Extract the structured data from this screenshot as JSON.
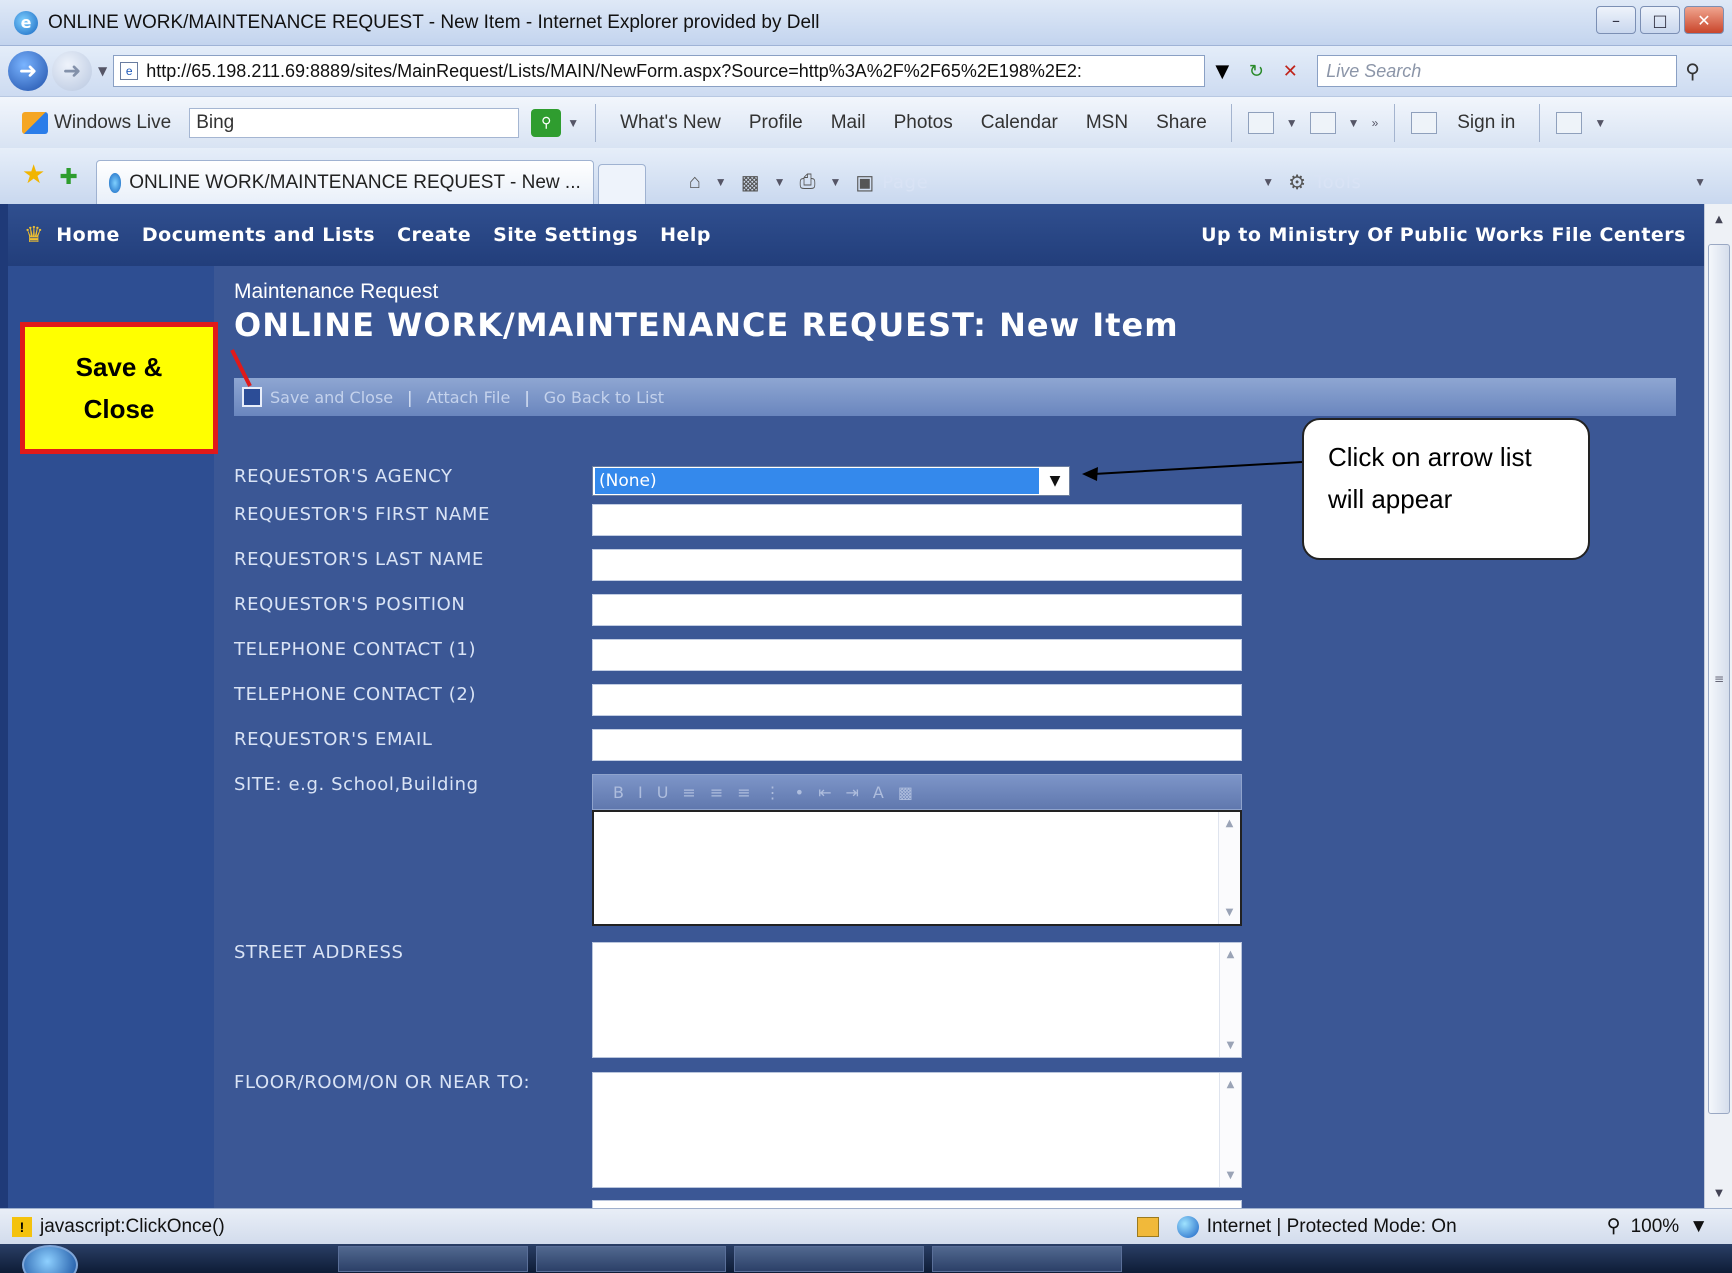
{
  "window": {
    "title": "ONLINE WORK/MAINTENANCE REQUEST - New Item - Internet Explorer provided by Dell"
  },
  "address_bar": {
    "url": "http://65.198.211.69:8889/sites/MainRequest/Lists/MAIN/NewForm.aspx?Source=http%3A%2F%2F65%2E198%2E2:",
    "search_placeholder": "Live Search"
  },
  "live_toolbar": {
    "brand": "Windows Live",
    "bing_value": "Bing",
    "links": [
      "What's New",
      "Profile",
      "Mail",
      "Photos",
      "Calendar",
      "MSN",
      "Share"
    ],
    "sign_in": "Sign in"
  },
  "tab": {
    "label": "ONLINE WORK/MAINTENANCE REQUEST - New ..."
  },
  "command_bar": {
    "page": "Page",
    "tools": "Tools"
  },
  "sharepoint": {
    "top_nav": [
      "Home",
      "Documents and Lists",
      "Create",
      "Site Settings",
      "Help"
    ],
    "up_link": "Up to Ministry Of Public Works File Centers",
    "breadcrumb": "Maintenance Request",
    "title": "ONLINE WORK/MAINTENANCE REQUEST:",
    "title_suffix": "New Item",
    "toolbar": {
      "save_close": "Save and Close",
      "attach_file": "Attach File",
      "go_back": "Go Back to List"
    },
    "fields": {
      "agency_label": "REQUESTOR'S AGENCY",
      "agency_value": "(None)",
      "first_name_label": "REQUESTOR'S FIRST NAME",
      "last_name_label": "REQUESTOR'S LAST NAME",
      "position_label": "REQUESTOR'S POSITION",
      "phone1_label": "TELEPHONE CONTACT (1)",
      "phone2_label": "TELEPHONE CONTACT (2)",
      "email_label": "REQUESTOR'S EMAIL",
      "site_label": "SITE: e.g. School,Building",
      "street_label": "STREET ADDRESS",
      "floor_label": "FLOOR/ROOM/ON OR NEAR TO:"
    }
  },
  "annotations": {
    "save_close_line1": "Save &",
    "save_close_line2": "Close",
    "arrow_note_line1": "Click on arrow list",
    "arrow_note_line2": "will appear"
  },
  "status_bar": {
    "status_text": "javascript:ClickOnce()",
    "zone": "Internet | Protected Mode: On",
    "zoom": "100%"
  },
  "colors": {
    "sharepoint_background": "#3b5795",
    "nav_bar": "#223e7b",
    "callout_fill": "#ffff00",
    "callout_border": "#e01a1a",
    "selected_option": "#3489ec"
  }
}
